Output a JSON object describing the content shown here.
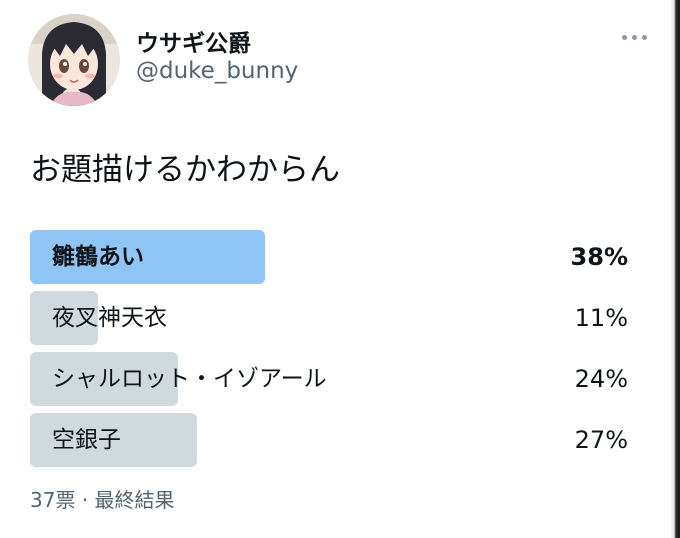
{
  "author": {
    "display_name": "ウサギ公爵",
    "handle": "@duke_bunny",
    "avatar_icon": "anime-girl-avatar"
  },
  "tweet": {
    "text": "お題描けるかわからん"
  },
  "poll": {
    "options": [
      {
        "label": "雛鶴あい",
        "percent": 38,
        "percent_text": "38%",
        "winner": true
      },
      {
        "label": "夜叉神天衣",
        "percent": 11,
        "percent_text": "11%",
        "winner": false
      },
      {
        "label": "シャルロット・イゾアール",
        "percent": 24,
        "percent_text": "24%",
        "winner": false
      },
      {
        "label": "空銀子",
        "percent": 27,
        "percent_text": "27%",
        "winner": false
      }
    ],
    "votes_text": "37票",
    "separator": "·",
    "status_text": "最終結果"
  },
  "colors": {
    "winner_bar": "#8ec5f5",
    "other_bar": "#cfd9de",
    "secondary_text": "#536471"
  },
  "more_icon": "more-horizontal-icon"
}
